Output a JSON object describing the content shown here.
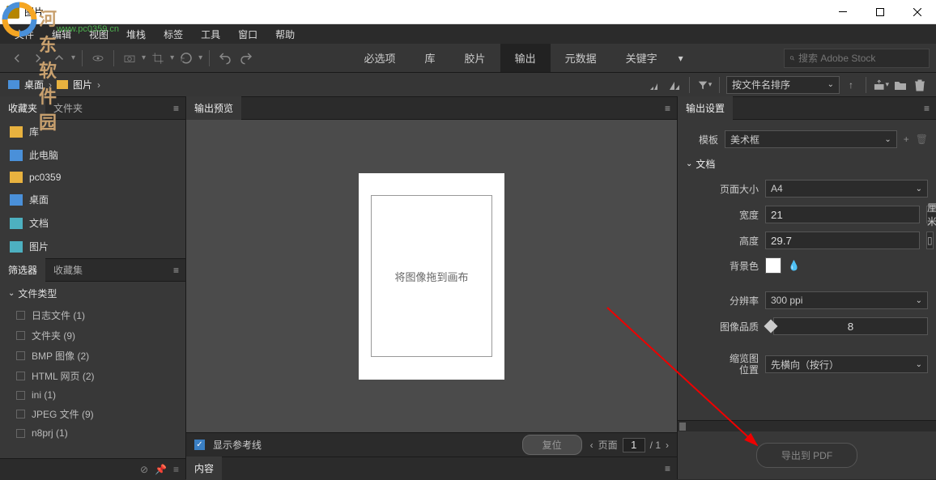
{
  "titlebar": {
    "title": "图片"
  },
  "watermark": {
    "text": "河东软件园",
    "url": "www.pc0359.cn"
  },
  "menu": [
    "文件",
    "编辑",
    "视图",
    "堆栈",
    "标签",
    "工具",
    "窗口",
    "帮助"
  ],
  "workspaces": {
    "items": [
      "必选项",
      "库",
      "胶片",
      "输出",
      "元数据",
      "关键字"
    ],
    "active": 3
  },
  "search": {
    "placeholder": "搜索 Adobe Stock"
  },
  "path": {
    "seg1": "桌面",
    "seg2": "图片"
  },
  "sort": {
    "label": "按文件名排序"
  },
  "leftTabs": {
    "fav": "收藏夹",
    "folders": "文件夹"
  },
  "favorites": [
    {
      "icon": "orange",
      "label": "库"
    },
    {
      "icon": "blue",
      "label": "此电脑"
    },
    {
      "icon": "orange",
      "label": "pc0359"
    },
    {
      "icon": "blue",
      "label": "桌面"
    },
    {
      "icon": "teal",
      "label": "文档"
    },
    {
      "icon": "teal",
      "label": "图片"
    }
  ],
  "filterTabs": {
    "filter": "筛选器",
    "collection": "收藏集"
  },
  "filterSection": {
    "header": "文件类型"
  },
  "filters": [
    "日志文件  (1)",
    "文件夹  (9)",
    "BMP 图像  (2)",
    "HTML 网页  (2)",
    "ini  (1)",
    "JPEG 文件  (9)",
    "n8prj  (1)"
  ],
  "centerTabs": {
    "preview": "输出预览",
    "content": "内容"
  },
  "canvas": {
    "hint": "将图像拖到画布"
  },
  "previewFooter": {
    "guides": "显示参考线",
    "reset": "复位",
    "pageLabel": "页面",
    "pageValue": "1",
    "pageTotal": "/  1"
  },
  "rightTabs": {
    "settings": "输出设置"
  },
  "settings": {
    "templateLabel": "模板",
    "templateValue": "美术框",
    "docSection": "文档",
    "pageSizeLabel": "页面大小",
    "pageSizeValue": "A4",
    "widthLabel": "宽度",
    "widthValue": "21",
    "widthUnit": "厘米",
    "heightLabel": "高度",
    "heightValue": "29.7",
    "bgLabel": "背景色",
    "resolutionLabel": "分辨率",
    "resolutionValue": "300 ppi",
    "qualityLabel": "图像品质",
    "qualityValue": "8",
    "thumbLabel1": "缩览图",
    "thumbLabel2": "位置",
    "thumbValue": "先横向（按行）",
    "exportBtn": "导出到 PDF"
  }
}
